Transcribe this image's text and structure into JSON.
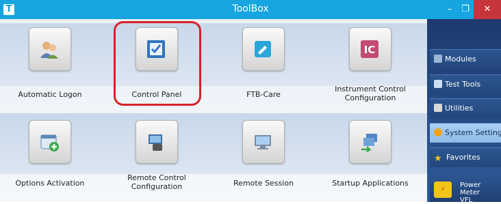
{
  "window": {
    "title": "ToolBox",
    "app_icon": "T",
    "minimize": "–",
    "maximize": "❐",
    "close": "✕"
  },
  "tiles": [
    {
      "label": "Automatic Logon",
      "icon": "users-icon"
    },
    {
      "label": "Control Panel",
      "icon": "control-panel-icon",
      "highlighted": true
    },
    {
      "label": "FTB-Care",
      "icon": "ftb-care-icon"
    },
    {
      "label": "Instrument Control\nConfiguration",
      "icon": "instrument-control-icon"
    },
    {
      "label": "Options Activation",
      "icon": "options-activation-icon"
    },
    {
      "label": "Remote Control\nConfiguration",
      "icon": "remote-control-icon"
    },
    {
      "label": "Remote Session",
      "icon": "remote-session-icon"
    },
    {
      "label": "Startup Applications",
      "icon": "startup-applications-icon"
    }
  ],
  "sidebar": {
    "items": [
      {
        "label": "Modules",
        "icon": "modules-icon"
      },
      {
        "label": "Test Tools",
        "icon": "test-tools-icon"
      },
      {
        "label": "Utilities",
        "icon": "utilities-icon"
      },
      {
        "label": "System Settings",
        "icon": "system-settings-icon",
        "active": true
      },
      {
        "label": "Favorites",
        "icon": "star-icon"
      }
    ],
    "power_meter": {
      "line1": "Power Meter",
      "line2": "VFL",
      "icon": "power-meter-icon"
    }
  },
  "colors": {
    "titlebar": "#16a5e0",
    "close": "#c7343a",
    "highlight": "#d9202a",
    "sidebar": "#1e3a6e"
  }
}
